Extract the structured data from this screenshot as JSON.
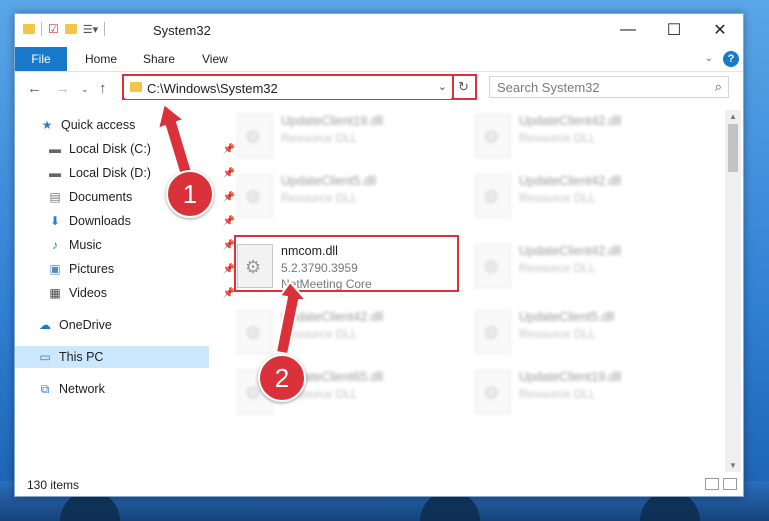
{
  "window": {
    "title": "System32",
    "controls": {
      "minimize": "—",
      "maximize": "☐",
      "close": "✕"
    }
  },
  "ribbon": {
    "file_tab": "File",
    "tabs": [
      "Home",
      "Share",
      "View"
    ],
    "help": "?"
  },
  "address": {
    "path": "C:\\Windows\\System32",
    "search_placeholder": "Search System32"
  },
  "nav": {
    "items": [
      {
        "label": "Quick access",
        "icon": "star-icon",
        "pinned": false
      },
      {
        "label": "Local Disk (C:)",
        "icon": "drive-icon",
        "pinned": true
      },
      {
        "label": "Local Disk (D:)",
        "icon": "drive-icon",
        "pinned": true
      },
      {
        "label": "Documents",
        "icon": "documents-icon",
        "pinned": true
      },
      {
        "label": "Downloads",
        "icon": "downloads-icon",
        "pinned": true
      },
      {
        "label": "Music",
        "icon": "music-icon",
        "pinned": true
      },
      {
        "label": "Pictures",
        "icon": "pictures-icon",
        "pinned": true
      },
      {
        "label": "Videos",
        "icon": "videos-icon",
        "pinned": true
      },
      {
        "label": "OneDrive",
        "icon": "cloud-icon",
        "pinned": false
      },
      {
        "label": "This PC",
        "icon": "computer-icon",
        "pinned": false,
        "selected": true
      },
      {
        "label": "Network",
        "icon": "network-icon",
        "pinned": false
      }
    ]
  },
  "files": {
    "left": [
      {
        "name": "UpdateClient19.dll",
        "line2": "Resource DLL"
      },
      {
        "name": "UpdateClient5.dll",
        "line2": "Resource DLL"
      },
      {
        "name": "nmcom.dll",
        "line2": "5.2.3790.3959",
        "line3": "NetMeeting Core"
      },
      {
        "name": "UpdateClient42.dll",
        "line2": "Resource DLL"
      },
      {
        "name": "UpdateClient65.dll",
        "line2": "Resource DLL"
      }
    ],
    "right": [
      {
        "name": "UpdateClient42.dll",
        "line2": "Resource DLL"
      },
      {
        "name": "UpdateClient42.dll",
        "line2": "Resource DLL"
      },
      {
        "name": "UpdateClient42.dll",
        "line2": "Resource DLL"
      },
      {
        "name": "UpdateClient5.dll",
        "line2": "Resource DLL"
      },
      {
        "name": "UpdateClient19.dll",
        "line2": "Resource DLL"
      }
    ]
  },
  "status": {
    "count": "130 items"
  },
  "callouts": {
    "one": "1",
    "two": "2"
  },
  "colors": {
    "accent": "#1979ca",
    "highlight": "#d9323a",
    "selection": "#cce8ff"
  }
}
